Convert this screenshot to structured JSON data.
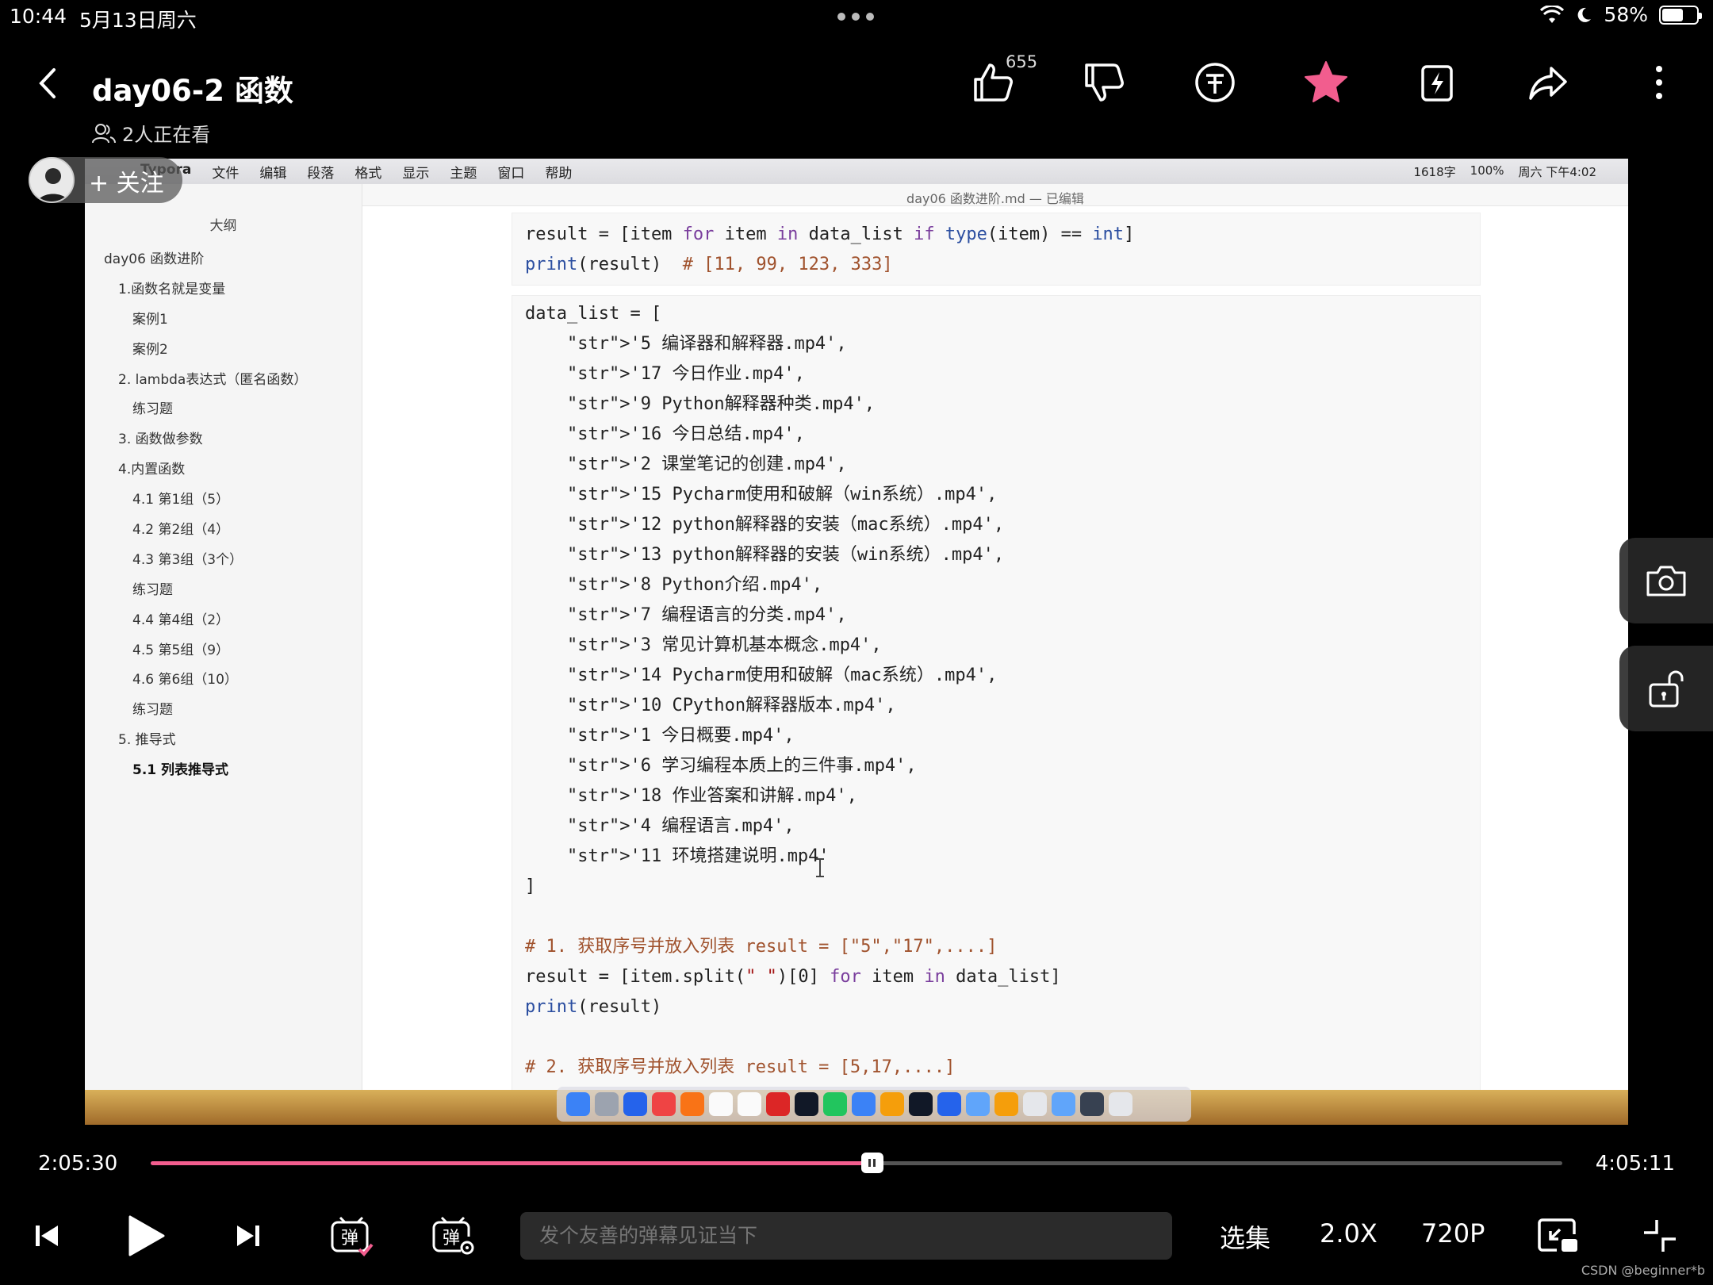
{
  "status": {
    "time": "10:44",
    "date": "5月13日周六",
    "battery": "58%"
  },
  "header": {
    "title": "day06-2 函数",
    "viewers": "2人正在看",
    "like_count": "655",
    "follow_label": "+ 关注"
  },
  "screen": {
    "menu": [
      "Typora",
      "文件",
      "编辑",
      "段落",
      "格式",
      "显示",
      "主题",
      "窗口",
      "帮助"
    ],
    "menu_right": [
      "1618字",
      "100%",
      "周六 下午4:02"
    ],
    "doc_title": "day06 函数进阶.md — 已编辑",
    "outline_title": "大纲",
    "outline": [
      {
        "label": "day06 函数进阶",
        "level": 1
      },
      {
        "label": "1.函数名就是变量",
        "level": 2
      },
      {
        "label": "案例1",
        "level": 3
      },
      {
        "label": "案例2",
        "level": 3
      },
      {
        "label": "2. lambda表达式（匿名函数）",
        "level": 2
      },
      {
        "label": "练习题",
        "level": 3
      },
      {
        "label": "3. 函数做参数",
        "level": 2
      },
      {
        "label": "4.内置函数",
        "level": 2
      },
      {
        "label": "4.1 第1组（5）",
        "level": 3
      },
      {
        "label": "4.2 第2组（4）",
        "level": 3
      },
      {
        "label": "4.3 第3组（3个）",
        "level": 3
      },
      {
        "label": "练习题",
        "level": 3
      },
      {
        "label": "4.4 第4组（2）",
        "level": 3
      },
      {
        "label": "4.5 第5组（9）",
        "level": 3
      },
      {
        "label": "4.6 第6组（10）",
        "level": 3
      },
      {
        "label": "练习题",
        "level": 3
      },
      {
        "label": "5. 推导式",
        "level": 2
      },
      {
        "label": "5.1 列表推导式",
        "level": 3,
        "active": true
      }
    ],
    "code_block_1": [
      "result = [item for item in data_list if type(item) == int]",
      "print(result)  # [11, 99, 123, 333]"
    ],
    "code_block_2": [
      "data_list = [",
      "    '5 编译器和解释器.mp4',",
      "    '17 今日作业.mp4',",
      "    '9 Python解释器种类.mp4',",
      "    '16 今日总结.mp4',",
      "    '2 课堂笔记的创建.mp4',",
      "    '15 Pycharm使用和破解（win系统）.mp4',",
      "    '12 python解释器的安装（mac系统）.mp4',",
      "    '13 python解释器的安装（win系统）.mp4',",
      "    '8 Python介绍.mp4',",
      "    '7 编程语言的分类.mp4',",
      "    '3 常见计算机基本概念.mp4',",
      "    '14 Pycharm使用和破解（mac系统）.mp4',",
      "    '10 CPython解释器版本.mp4',",
      "    '1 今日概要.mp4',",
      "    '6 学习编程本质上的三件事.mp4',",
      "    '18 作业答案和讲解.mp4',",
      "    '4 编程语言.mp4',",
      "    '11 环境搭建说明.mp4'",
      "]",
      "",
      "# 1. 获取序号并放入列表 result = [\"5\",\"17\",....]",
      "result = [item.split(\" \")[0] for item in data_list]",
      "print(result)",
      "",
      "# 2. 获取序号并放入列表 result = [5,17,....]"
    ]
  },
  "player": {
    "current_time": "2:05:30",
    "total_time": "4:05:11",
    "progress": 0.511,
    "danmaku_placeholder": "发个友善的弹幕见证当下",
    "episodes_label": "选集",
    "speed_label": "2.0X",
    "quality_label": "720P",
    "danmaku_icon_label": "弹",
    "watermark": "CSDN @beginner*b"
  },
  "colors": {
    "accent": "#f25d8e",
    "favorite": "#f25d8e"
  }
}
